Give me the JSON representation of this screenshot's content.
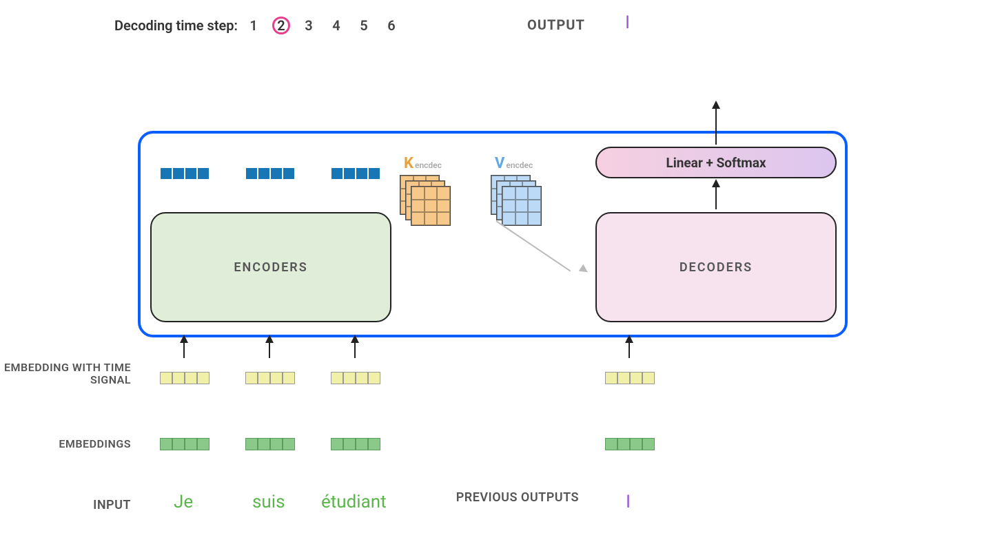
{
  "header": {
    "time_step_label": "Decoding time step:",
    "steps": [
      "1",
      "2",
      "3",
      "4",
      "5",
      "6"
    ],
    "current_step_index": 1,
    "output_label": "OUTPUT",
    "output_value": "I"
  },
  "boxes": {
    "encoders_label": "ENCODERS",
    "decoders_label": "DECODERS",
    "softmax_label": "Linear + Softmax"
  },
  "kv": {
    "k_symbol": "K",
    "k_subscript": "encdec",
    "v_symbol": "V",
    "v_subscript": "encdec"
  },
  "row_labels": {
    "embedding_time_signal": "EMBEDDING WITH TIME SIGNAL",
    "embeddings": "EMBEDDINGS",
    "input": "INPUT",
    "previous_outputs": "PREVIOUS OUTPUTS"
  },
  "inputs": {
    "words": [
      "Je",
      "suis",
      "étudiant"
    ]
  },
  "previous_outputs": {
    "words": [
      "I"
    ]
  },
  "vector_cells": 4,
  "colors": {
    "container_border": "#0b5fff",
    "encoder_bg": "#e0edd8",
    "decoder_bg": "#f6e3ed",
    "enc_out_vec": "#1976b4",
    "embedding_time": "#f0f0a8",
    "embedding": "#8bc98b",
    "k_matrix": "#f6c98a",
    "v_matrix": "#bcdaf6",
    "input_word": "#5ab54a",
    "output_word": "#9b59d6",
    "highlight_ring": "#e83e8c"
  }
}
